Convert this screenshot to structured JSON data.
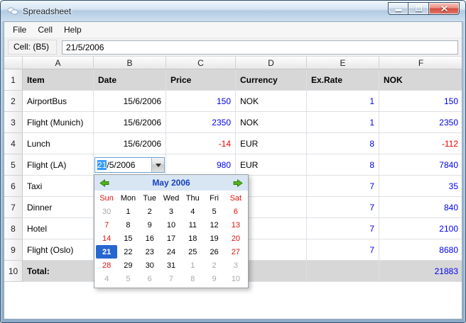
{
  "window": {
    "title": "Spreadsheet"
  },
  "menu": {
    "items": [
      "File",
      "Cell",
      "Help"
    ]
  },
  "toolbar": {
    "cell_label": "Cell: (B5)",
    "cell_value": "21/5/2006"
  },
  "sheet": {
    "column_headers": [
      "A",
      "B",
      "C",
      "D",
      "E",
      "F"
    ],
    "field_headers": [
      "Item",
      "Date",
      "Price",
      "Currency",
      "Ex.Rate",
      "NOK"
    ],
    "rows": [
      {
        "num": "2",
        "item": "AirportBus",
        "date": "15/6/2006",
        "price": "150",
        "currency": "NOK",
        "exrate": "1",
        "nok": "150"
      },
      {
        "num": "3",
        "item": "Flight (Munich)",
        "date": "15/6/2006",
        "price": "2350",
        "currency": "NOK",
        "exrate": "1",
        "nok": "2350"
      },
      {
        "num": "4",
        "item": "Lunch",
        "date": "15/6/2006",
        "price": "-14",
        "currency": "EUR",
        "exrate": "8",
        "nok": "-112"
      },
      {
        "num": "5",
        "item": "Flight (LA)",
        "date": "21/5/2006",
        "price": "980",
        "currency": "EUR",
        "exrate": "8",
        "nok": "7840",
        "editing": true
      },
      {
        "num": "6",
        "item": "Taxi",
        "date": "",
        "price": "",
        "currency": "",
        "exrate": "7",
        "nok": "35"
      },
      {
        "num": "7",
        "item": "Dinner",
        "date": "",
        "price": "",
        "currency": "",
        "exrate": "7",
        "nok": "840"
      },
      {
        "num": "8",
        "item": "Hotel",
        "date": "",
        "price": "",
        "currency": "",
        "exrate": "7",
        "nok": "2100"
      },
      {
        "num": "9",
        "item": "Flight (Oslo)",
        "date": "",
        "price": "",
        "currency": "",
        "exrate": "7",
        "nok": "8680"
      },
      {
        "num": "10",
        "item": "Total:",
        "date": "",
        "price": "",
        "currency": "",
        "exrate": "",
        "nok": "21883",
        "total": true
      }
    ]
  },
  "editor": {
    "full": "21/5/2006",
    "selected": "21",
    "rest": "/5/2006"
  },
  "calendar": {
    "title": "May 2006",
    "day_headers": [
      [
        "Sun",
        "we"
      ],
      [
        "Mon",
        "n"
      ],
      [
        "Tue",
        "n"
      ],
      [
        "Wed",
        "n"
      ],
      [
        "Thu",
        "n"
      ],
      [
        "Fri",
        "n"
      ],
      [
        "Sat",
        "we"
      ]
    ],
    "weeks": [
      [
        [
          "30",
          "out"
        ],
        [
          "1",
          "n"
        ],
        [
          "2",
          "n"
        ],
        [
          "3",
          "n"
        ],
        [
          "4",
          "n"
        ],
        [
          "5",
          "n"
        ],
        [
          "6",
          "we"
        ]
      ],
      [
        [
          "7",
          "we"
        ],
        [
          "8",
          "n"
        ],
        [
          "9",
          "n"
        ],
        [
          "10",
          "n"
        ],
        [
          "11",
          "n"
        ],
        [
          "12",
          "n"
        ],
        [
          "13",
          "we"
        ]
      ],
      [
        [
          "14",
          "we"
        ],
        [
          "15",
          "n"
        ],
        [
          "16",
          "n"
        ],
        [
          "17",
          "n"
        ],
        [
          "18",
          "n"
        ],
        [
          "19",
          "n"
        ],
        [
          "20",
          "we"
        ]
      ],
      [
        [
          "21",
          "sel"
        ],
        [
          "22",
          "n"
        ],
        [
          "23",
          "n"
        ],
        [
          "24",
          "n"
        ],
        [
          "25",
          "n"
        ],
        [
          "26",
          "n"
        ],
        [
          "27",
          "we"
        ]
      ],
      [
        [
          "28",
          "we"
        ],
        [
          "29",
          "n"
        ],
        [
          "30",
          "n"
        ],
        [
          "31",
          "n"
        ],
        [
          "1",
          "out"
        ],
        [
          "2",
          "out"
        ],
        [
          "3",
          "out"
        ]
      ],
      [
        [
          "4",
          "out"
        ],
        [
          "5",
          "out"
        ],
        [
          "6",
          "out"
        ],
        [
          "7",
          "out"
        ],
        [
          "8",
          "out"
        ],
        [
          "9",
          "out"
        ],
        [
          "10",
          "out"
        ]
      ]
    ]
  },
  "icons": {
    "app": "spreadsheet-app-icon",
    "minimize": "minimize-icon",
    "maximize": "maximize-icon",
    "close": "close-icon",
    "dropdown": "down-arrow-icon",
    "prev_month": "green-left-arrow-icon",
    "next_month": "green-right-arrow-icon"
  },
  "colors": {
    "positive_number": "#0000f0",
    "negative_number": "#f00000",
    "weekend_day": "#e01010",
    "out_of_month_day": "#a9a9a9",
    "selected_day_bg": "#2667cf",
    "text_selection_bg": "#3399ff",
    "calendar_nav_bg": "#d8e6f4",
    "gray_row_bg": "#d7d7d7"
  }
}
